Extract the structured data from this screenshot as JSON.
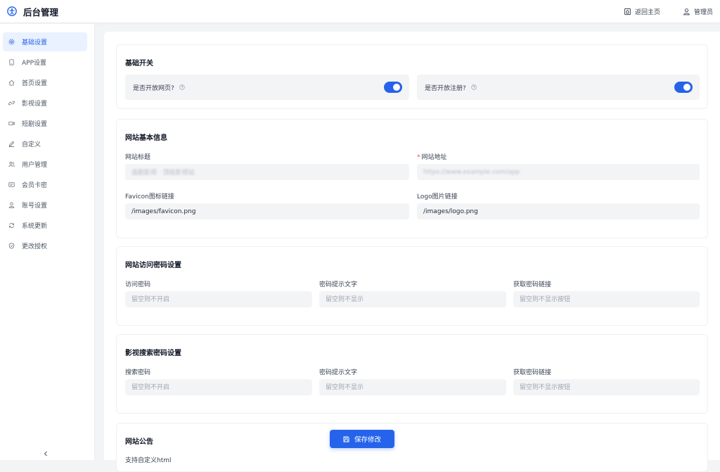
{
  "app": {
    "title": "后台管理",
    "accent": "#2563eb"
  },
  "topbar": {
    "home_label": "返回主页",
    "user_label": "管理员"
  },
  "sidebar": {
    "items": [
      {
        "label": "基础设置",
        "icon": "settings-icon",
        "active": true
      },
      {
        "label": "APP设置",
        "icon": "phone-icon"
      },
      {
        "label": "首页设置",
        "icon": "home-icon"
      },
      {
        "label": "影视设置",
        "icon": "link-icon"
      },
      {
        "label": "短剧设置",
        "icon": "video-icon"
      },
      {
        "label": "自定义",
        "icon": "edit-icon"
      },
      {
        "label": "用户管理",
        "icon": "users-icon"
      },
      {
        "label": "会员卡密",
        "icon": "card-icon"
      },
      {
        "label": "账号设置",
        "icon": "user-icon"
      },
      {
        "label": "系统更新",
        "icon": "refresh-icon"
      },
      {
        "label": "更改授权",
        "icon": "shield-icon"
      }
    ]
  },
  "basic_switch": {
    "title": "基础开关",
    "open_web": {
      "label": "是否开放网页?",
      "enabled": true
    },
    "open_register": {
      "label": "是否开放注册?",
      "enabled": true
    }
  },
  "site_info": {
    "title": "网站基本信息",
    "site_title": {
      "label": "网站标题",
      "value": "追剧影视 · 顶级影视站"
    },
    "site_url": {
      "label": "网站地址",
      "value": "https://www.example.com/app"
    },
    "favicon": {
      "label": "Favicon图标链接",
      "value": "/images/favicon.png"
    },
    "logo": {
      "label": "Logo图片链接",
      "value": "/images/logo.png"
    }
  },
  "access_password": {
    "title": "网站访问密码设置",
    "password": {
      "label": "访问密码",
      "placeholder": "留空则不开启"
    },
    "hint": {
      "label": "密码提示文字",
      "placeholder": "留空则不显示"
    },
    "link": {
      "label": "获取密码链接",
      "placeholder": "留空则不显示按钮"
    }
  },
  "search_password": {
    "title": "影视搜索密码设置",
    "password": {
      "label": "搜索密码",
      "placeholder": "留空则不开启"
    },
    "hint": {
      "label": "密码提示文字",
      "placeholder": "留空则不显示"
    },
    "link": {
      "label": "获取密码链接",
      "placeholder": "留空则不显示按钮"
    }
  },
  "announcement": {
    "title": "网站公告",
    "subtitle": "支持自定义html"
  },
  "actions": {
    "save_label": "保存修改"
  }
}
